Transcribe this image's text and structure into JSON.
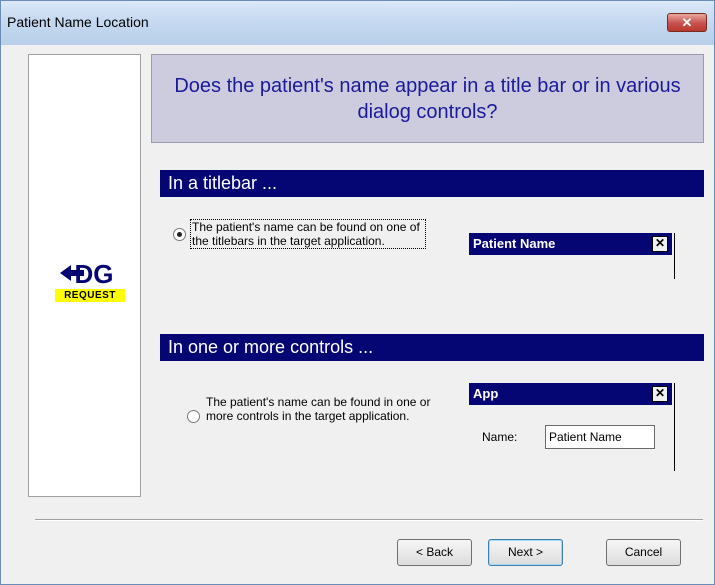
{
  "window": {
    "title": "Patient Name Location",
    "close_glyph": "✕"
  },
  "logo": {
    "mark_text": "DG",
    "word": "REQUEST"
  },
  "question": "Does the patient's name appear in a title bar or in various dialog controls?",
  "sections": [
    {
      "header": "In a titlebar ...",
      "option_label": "The patient's name can be found on one of the titlebars in the target application.",
      "checked": true,
      "preview": {
        "title": "Patient Name",
        "close_glyph": "✕"
      }
    },
    {
      "header": "In one or more controls ...",
      "option_label": "The patient's name can be found in one or more controls in the target application.",
      "checked": false,
      "preview": {
        "title": "App",
        "close_glyph": "✕",
        "field_label": "Name:",
        "field_value": "Patient Name"
      }
    }
  ],
  "buttons": {
    "back": "< Back",
    "next": "Next >",
    "cancel": "Cancel"
  },
  "colors": {
    "section_header_bg": "#050574",
    "question_bg": "#ccccde",
    "question_text": "#1a1a9a",
    "logo_band": "#ffff00",
    "close_button": "#c75050"
  }
}
